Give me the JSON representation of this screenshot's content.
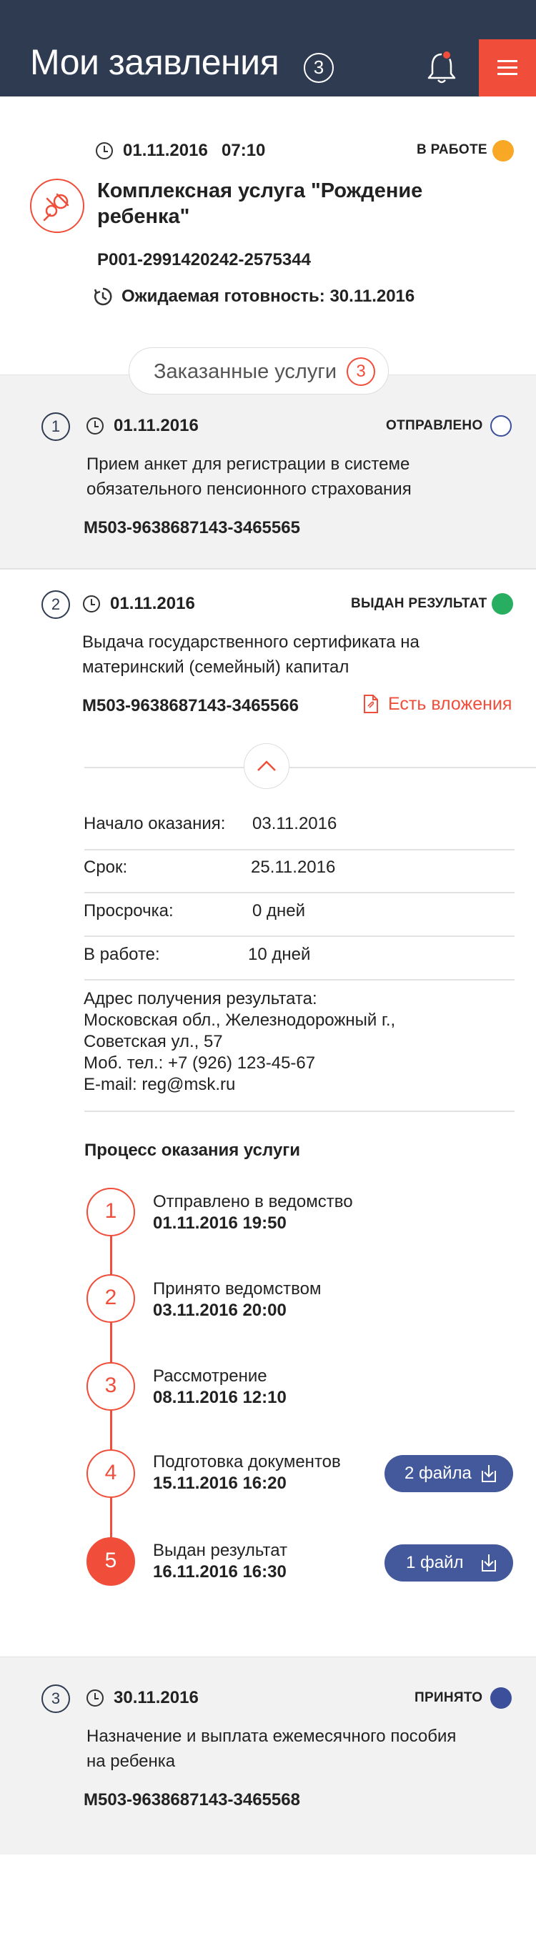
{
  "header": {
    "title": "Мои заявления",
    "count": "3"
  },
  "application": {
    "date": "01.11.2016",
    "time": "07:10",
    "status": "В РАБОТЕ",
    "title_line1": "Комплексная услуга \"Рождение",
    "title_line2": "ребенка\"",
    "code": "P001-2991420242-2575344",
    "readiness": "Ожидаемая готовность: 30.11.2016"
  },
  "ordered_services": {
    "label": "Заказанные услуги",
    "count": "3"
  },
  "services": [
    {
      "num": "1",
      "date": "01.11.2016",
      "status": "ОТПРАВЛЕНО",
      "title_line1": "Прием анкет для регистрации в системе",
      "title_line2": "обязательного пенсионного страхования",
      "code": "M503-9638687143-3465565"
    },
    {
      "num": "2",
      "date": "01.11.2016",
      "status": "ВЫДАН РЕЗУЛЬТАТ",
      "title_line1": "Выдача государственного сертификата на",
      "title_line2": "материнский (семейный) капитал",
      "code": "M503-9638687143-3465566",
      "attachments": "Есть вложения",
      "details": {
        "start_label": "Начало оказания:",
        "start_value": "03.11.2016",
        "deadline_label": "Срок:",
        "deadline_value": "25.11.2016",
        "overdue_label": "Просрочка:",
        "overdue_value": "0 дней",
        "inwork_label": "В работе:",
        "inwork_value": "10 дней",
        "address_label": "Адрес получения результата:",
        "address_line1": "Московская обл., Железнодорожный г.,",
        "address_line2": "Советская ул., 57",
        "phone": "Моб. тел.: +7 (926) 123-45-67",
        "email": "E-mail: reg@msk.ru"
      },
      "process_title": "Процесс оказания услуги",
      "steps": [
        {
          "num": "1",
          "label": "Отправлено в ведомство",
          "datetime": "01.11.2016 19:50"
        },
        {
          "num": "2",
          "label": "Принято ведомством",
          "datetime": "03.11.2016 20:00"
        },
        {
          "num": "3",
          "label": "Рассмотрение",
          "datetime": "08.11.2016 12:10"
        },
        {
          "num": "4",
          "label": "Подготовка документов",
          "datetime": "15.11.2016 16:20",
          "files": "2 файла"
        },
        {
          "num": "5",
          "label": "Выдан результат",
          "datetime": "16.11.2016 16:30",
          "files": "1 файл"
        }
      ]
    },
    {
      "num": "3",
      "date": "30.11.2016",
      "status": "ПРИНЯТО",
      "title_line1": "Назначение и выплата ежемесячного пособия",
      "title_line2": "на ребенка",
      "code": "M503-9638687143-3465568"
    }
  ],
  "colors": {
    "header_bg": "#2f3b50",
    "accent": "#f04e3a",
    "status_in_work": "#f9a825",
    "status_result": "#27ae60",
    "status_accepted": "#3b4f9a",
    "file_button": "#44599c"
  }
}
